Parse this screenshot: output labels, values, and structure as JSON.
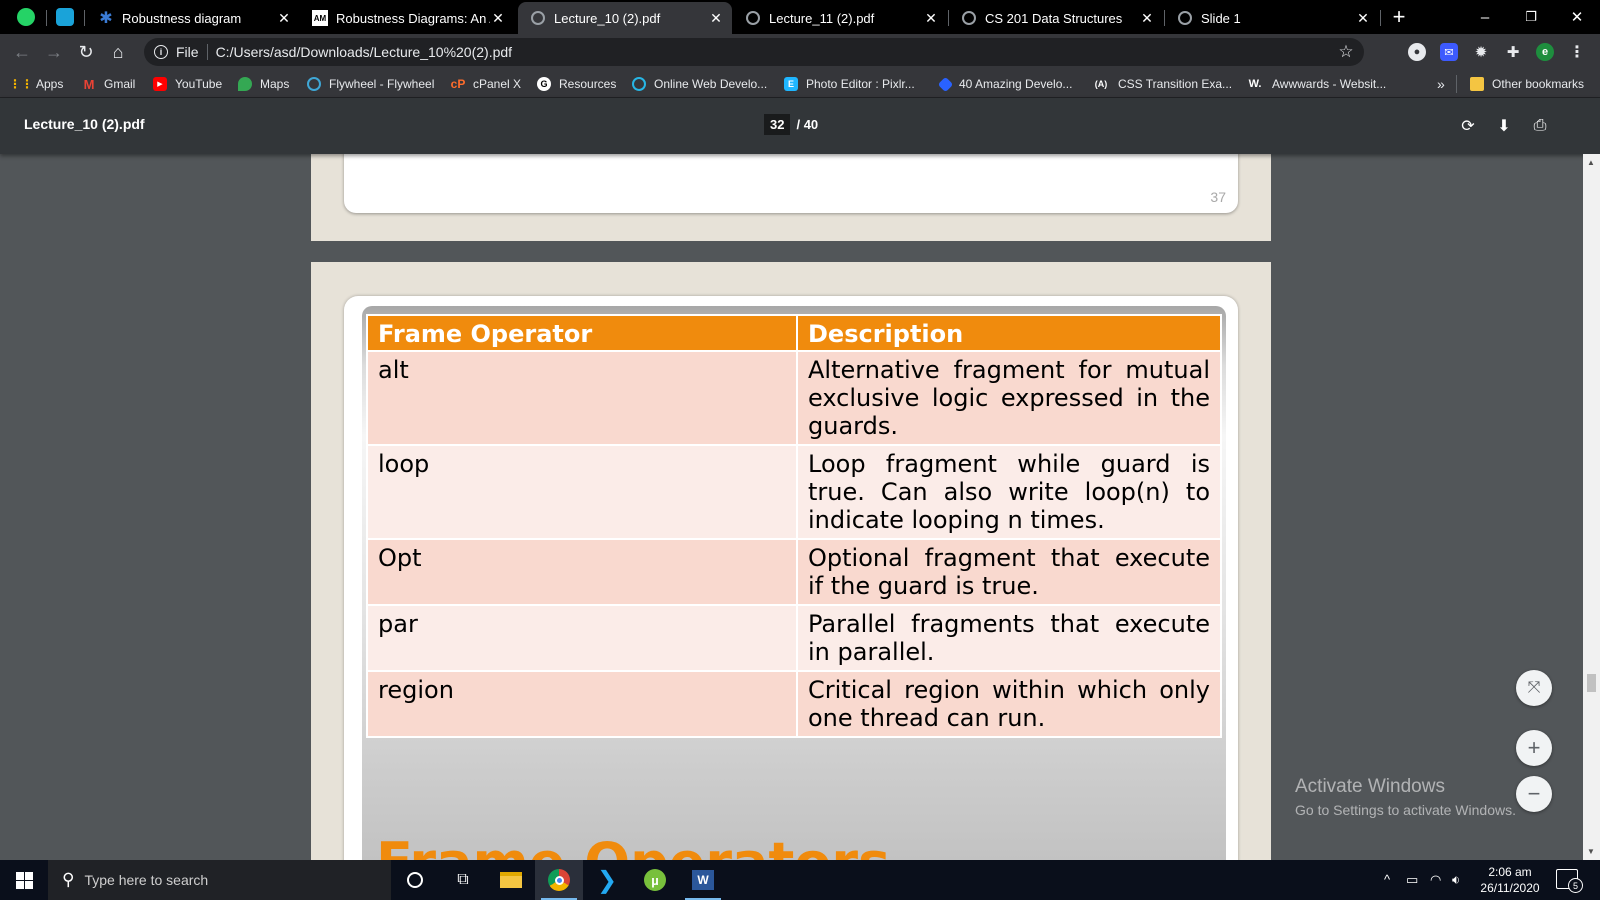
{
  "browser": {
    "tabs": [
      {
        "title": "Robustness diagram",
        "icon": "robustness-diagram-icon",
        "active": false
      },
      {
        "title": "Robustness Diagrams: An Ag",
        "icon": "agile-modeling-icon",
        "fav_text": "AM",
        "active": false
      },
      {
        "title": "Lecture_10 (2).pdf",
        "icon": "globe-icon",
        "active": true
      },
      {
        "title": "Lecture_11 (2).pdf",
        "icon": "globe-icon",
        "active": false
      },
      {
        "title": "CS 201 Data Structures",
        "icon": "globe-icon",
        "active": false
      },
      {
        "title": "Slide 1",
        "icon": "globe-icon",
        "active": false
      }
    ],
    "new_tab_symbol": "+",
    "window_controls": {
      "minimize": "–",
      "restore": "❐",
      "close": "✕"
    },
    "address": {
      "scheme_label": "File",
      "url": "C:/Users/asd/Downloads/Lecture_10%20(2).pdf"
    },
    "profile_initial": "e",
    "bookmarks": [
      {
        "label": "Apps",
        "icon": "apps-grid-icon"
      },
      {
        "label": "Gmail",
        "icon": "gmail-icon"
      },
      {
        "label": "YouTube",
        "icon": "youtube-icon"
      },
      {
        "label": "Maps",
        "icon": "maps-pin-icon"
      },
      {
        "label": "Flywheel - Flywheel",
        "icon": "flywheel-icon"
      },
      {
        "label": "cPanel X",
        "icon": "cpanel-icon"
      },
      {
        "label": "Resources",
        "icon": "resources-icon",
        "fav_text": "G"
      },
      {
        "label": "Online Web Develo...",
        "icon": "web-dev-icon"
      },
      {
        "label": "Photo Editor : Pixlr...",
        "icon": "pixlr-icon",
        "fav_text": "E"
      },
      {
        "label": "40 Amazing Develo...",
        "icon": "diamond-icon"
      },
      {
        "label": "CSS Transition Exa...",
        "icon": "css-transition-icon",
        "fav_text": "(A)"
      },
      {
        "label": "Awwwards - Websit...",
        "icon": "awwwards-icon",
        "fav_text": "W."
      }
    ],
    "bookmarks_overflow": "»",
    "other_bookmarks": "Other bookmarks"
  },
  "pdf": {
    "title": "Lecture_10 (2).pdf",
    "current_page": "32",
    "total_pages": "/ 40",
    "prev_page_number": "37",
    "table": {
      "headers": [
        "Frame Operator",
        "Description"
      ],
      "rows": [
        {
          "op": "alt",
          "desc": "Alternative fragment for mutual exclusive logic expressed in the guards."
        },
        {
          "op": "loop",
          "desc": "Loop fragment while guard is true. Can also write loop(n) to indicate looping n times."
        },
        {
          "op": "Opt",
          "desc": "Optional fragment that execute if the guard is true."
        },
        {
          "op": "par",
          "desc": "Parallel fragments that execute in parallel."
        },
        {
          "op": "region",
          "desc": "Critical region within which only one thread can run."
        }
      ]
    },
    "slide_heading": "Frame Operators",
    "zoom": {
      "fit": "⤧",
      "in": "+",
      "out": "−"
    }
  },
  "watermark": {
    "title": "Activate Windows",
    "subtitle": "Go to Settings to activate Windows."
  },
  "taskbar": {
    "search_placeholder": "Type here to search",
    "time": "2:06 am",
    "date": "26/11/2020",
    "notification_count": "5"
  },
  "colors": {
    "table_header": "#f08b0d",
    "row_odd": "#f9d9cf",
    "row_even": "#fbece8",
    "pdf_toolbar": "#323639",
    "viewer_bg": "#525659"
  }
}
